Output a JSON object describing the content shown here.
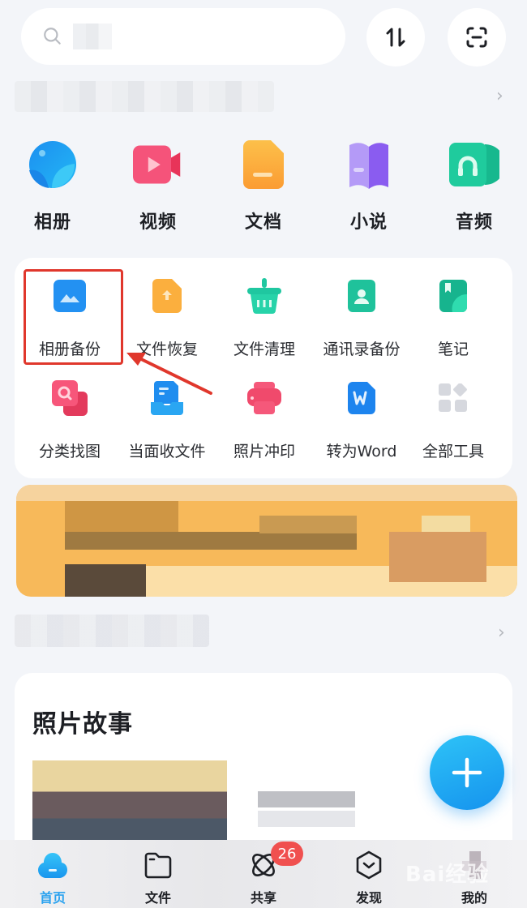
{
  "header": {
    "search_placeholder": "",
    "transfer_icon": "sort-transfer-icon",
    "scan_icon": "scan-icon"
  },
  "categories": [
    {
      "label": "相册",
      "icon": "album-icon",
      "color": "#1b8ff0"
    },
    {
      "label": "视频",
      "icon": "video-icon",
      "color": "#f25074"
    },
    {
      "label": "文档",
      "icon": "document-icon",
      "color": "#fbab3a"
    },
    {
      "label": "小说",
      "icon": "novel-icon",
      "color": "#8b5cf6"
    },
    {
      "label": "音频",
      "icon": "audio-icon",
      "color": "#1fc59a"
    }
  ],
  "tools": [
    {
      "label": "相册备份",
      "icon": "album-backup-icon",
      "highlighted": true
    },
    {
      "label": "文件恢复",
      "icon": "file-recovery-icon"
    },
    {
      "label": "文件清理",
      "icon": "file-cleanup-icon"
    },
    {
      "label": "通讯录备份",
      "icon": "contacts-backup-icon"
    },
    {
      "label": "笔记",
      "icon": "notes-icon"
    },
    {
      "label": "分类找图",
      "icon": "classify-search-icon"
    },
    {
      "label": "当面收文件",
      "icon": "receive-file-icon"
    },
    {
      "label": "照片冲印",
      "icon": "photo-print-icon"
    },
    {
      "label": "转为Word",
      "icon": "convert-word-icon"
    },
    {
      "label": "全部工具",
      "icon": "all-tools-icon"
    }
  ],
  "story": {
    "title": "照片故事"
  },
  "fab": {
    "icon": "plus-icon"
  },
  "bottom_nav": [
    {
      "label": "首页",
      "icon": "home-cloud-icon",
      "active": true
    },
    {
      "label": "文件",
      "icon": "folder-icon"
    },
    {
      "label": "共享",
      "icon": "share-orbit-icon",
      "badge": "26"
    },
    {
      "label": "发现",
      "icon": "discover-icon"
    },
    {
      "label": "我的",
      "icon": "profile-icon"
    }
  ],
  "watermark": "Bai经验",
  "colors": {
    "accent": "#2aa2ef",
    "highlight_box": "#e0372c",
    "badge": "#f0504f"
  }
}
